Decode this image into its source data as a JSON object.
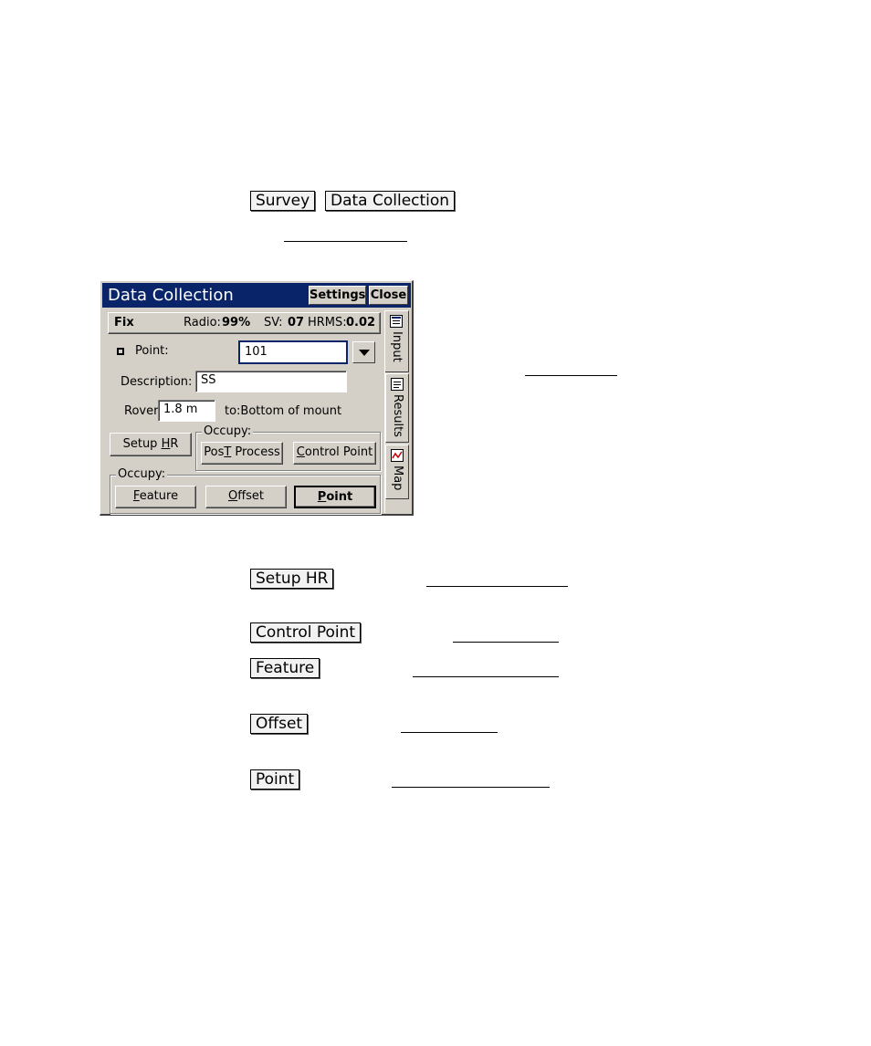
{
  "doc": {
    "menu_path": [
      "Survey",
      "Data Collection"
    ],
    "buttons": [
      "Setup HR",
      "Control Point",
      "Feature",
      "Offset",
      "Point"
    ]
  },
  "dialog": {
    "title": "Data Collection",
    "title_buttons": {
      "settings": "Settings",
      "close": "Close"
    },
    "status": {
      "fix": "Fix",
      "radio_label": "Radio:",
      "radio_value": "99%",
      "sv_label": "SV:",
      "sv_value": "07",
      "hrms_label": "HRMS:",
      "hrms_value": "0.02"
    },
    "point": {
      "label": "Point:",
      "value": "101"
    },
    "description": {
      "label": "Description:",
      "value": "SS"
    },
    "rover": {
      "label": "Rover:",
      "value": "1.8 m",
      "to_text": "to:Bottom of mount"
    },
    "setup_hr": {
      "pre": "Setup ",
      "accel": "H",
      "post": "R"
    },
    "occupy_group_1": {
      "label": "Occupy:",
      "post_process": {
        "pre": "Pos",
        "accel": "T",
        "post": " Process"
      },
      "control_point": {
        "pre": "",
        "accel": "C",
        "post": "ontrol Point"
      }
    },
    "occupy_group_2": {
      "label": "Occupy:",
      "feature": {
        "pre": "",
        "accel": "F",
        "post": "eature"
      },
      "offset": {
        "pre": "",
        "accel": "O",
        "post": "ffset"
      },
      "point": {
        "pre": "",
        "accel": "P",
        "post": "oint"
      }
    },
    "tabs": [
      "Input",
      "Results",
      "Map"
    ]
  },
  "colors": {
    "titlebar": "#0a246a",
    "face": "#d4d0c8",
    "focus_border": "#0a246a"
  }
}
